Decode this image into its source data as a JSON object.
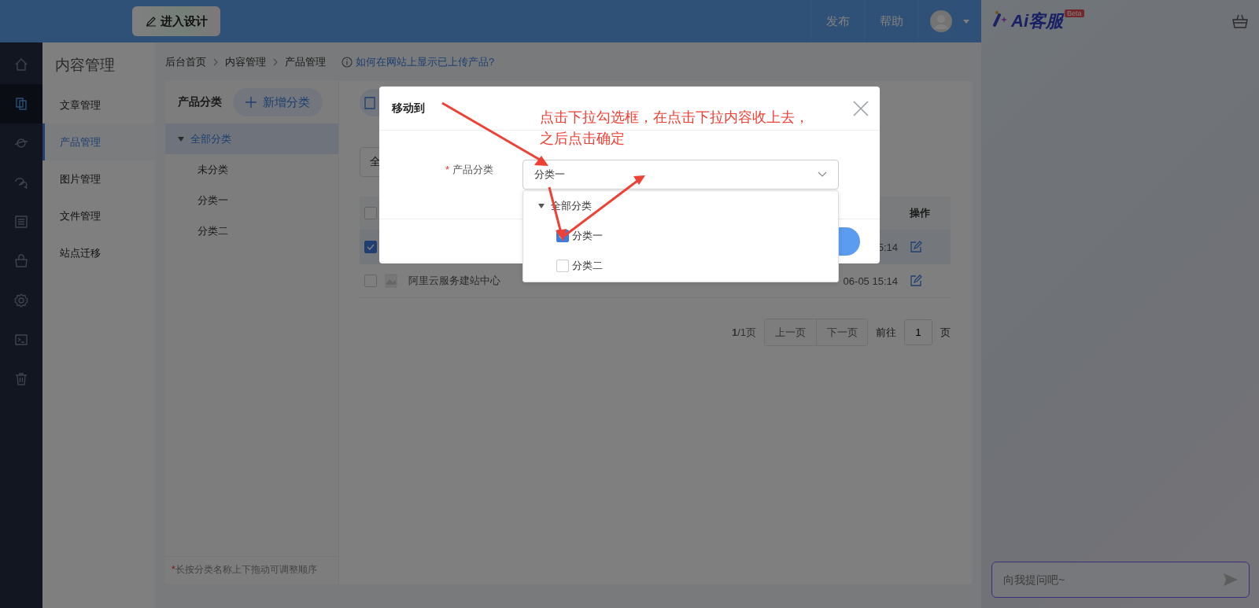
{
  "topbar": {
    "design_button": "进入设计",
    "actions": [
      "发布",
      "帮助"
    ]
  },
  "rail": [
    {
      "selected": false
    },
    {
      "selected": true
    },
    {
      "selected": false
    },
    {
      "selected": false
    },
    {
      "selected": false
    },
    {
      "selected": false
    },
    {
      "selected": false
    },
    {
      "selected": false
    },
    {
      "selected": false
    }
  ],
  "sidebar": {
    "title": "内容管理",
    "items": [
      {
        "label": "文章管理",
        "selected": false
      },
      {
        "label": "产品管理",
        "selected": true
      },
      {
        "label": "图片管理",
        "selected": false
      },
      {
        "label": "文件管理",
        "selected": false
      },
      {
        "label": "站点迁移",
        "selected": false
      }
    ]
  },
  "breadcrumb": [
    "后台首页",
    "内容管理",
    "产品管理"
  ],
  "help_link": "如何在网站上显示已上传产品?",
  "categories": {
    "title": "产品分类",
    "add_button": "新增分类",
    "tree": {
      "label": "全部分类",
      "expanded": true,
      "selected": true,
      "children": [
        {
          "label": "未分类",
          "selected": false
        },
        {
          "label": "分类一",
          "selected": false
        },
        {
          "label": "分类二",
          "selected": false
        }
      ]
    },
    "note_mark": "*",
    "note": "长按分类名称上下拖动可调整顺序"
  },
  "filter": {
    "value": "全"
  },
  "table": {
    "header_checked": false,
    "header": "操作",
    "rows": [
      {
        "selected": true,
        "name": "",
        "time": "5:14"
      },
      {
        "selected": false,
        "name": "阿里云服务建站中心",
        "time": "06-05 15:14"
      }
    ]
  },
  "pagination": {
    "page_info": "**1**/1页",
    "prev": "上一页",
    "next": "下一页",
    "goto": "前往",
    "page": "1",
    "unit": "页"
  },
  "ai_panel": {
    "logo": "Ai客服",
    "badge": "Beta",
    "placeholder": "向我提问吧~"
  },
  "dialog": {
    "title": "移动到",
    "required": true,
    "field_label": "产品分类",
    "value": "分类一",
    "dropdown": {
      "label": "全部分类",
      "expanded": true,
      "children": [
        {
          "label": "分类一",
          "checked": true
        },
        {
          "label": "分类二",
          "checked": false
        }
      ]
    }
  },
  "annotation": {
    "lines": [
      "点击下拉勾选框，在点击下拉内容收上去，",
      "之后点击确定"
    ]
  }
}
